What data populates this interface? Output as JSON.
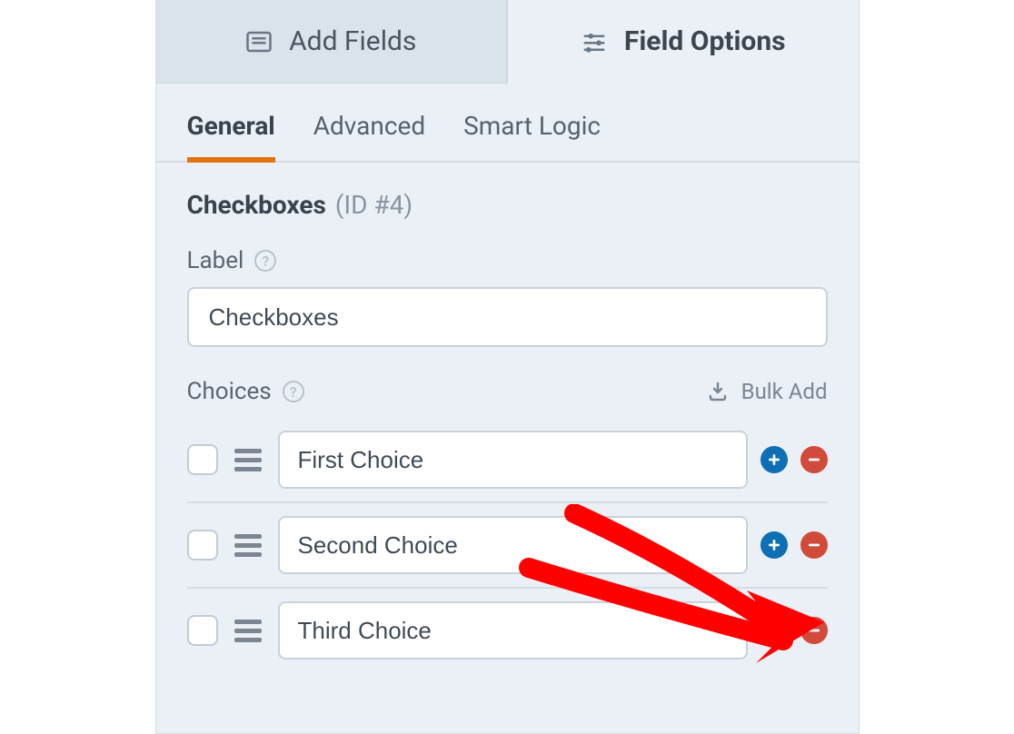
{
  "main_tabs": {
    "add_fields": "Add Fields",
    "field_options": "Field Options"
  },
  "sub_tabs": {
    "general": "General",
    "advanced": "Advanced",
    "smart_logic": "Smart Logic"
  },
  "field": {
    "type": "Checkboxes",
    "id_label": "(ID #4)"
  },
  "label_section": {
    "title": "Label",
    "value": "Checkboxes"
  },
  "choices_section": {
    "title": "Choices",
    "bulk_add": "Bulk Add",
    "items": [
      {
        "value": "First Choice"
      },
      {
        "value": "Second Choice"
      },
      {
        "value": "Third Choice"
      }
    ]
  }
}
